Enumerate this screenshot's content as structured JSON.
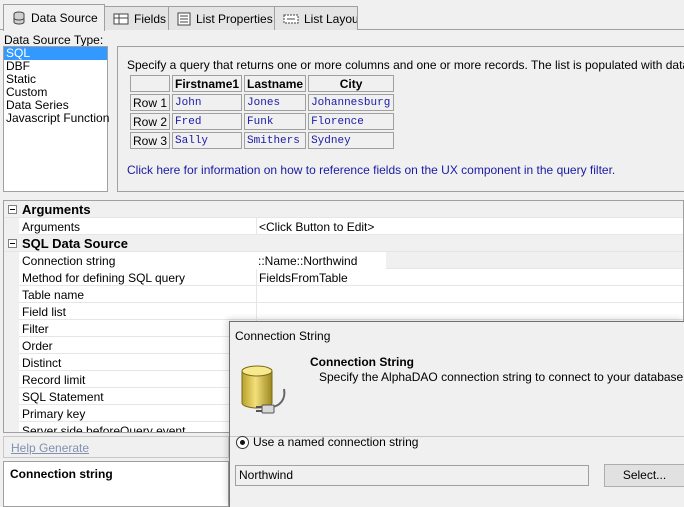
{
  "tabs": [
    {
      "label": "Data Source",
      "icon": "database-icon",
      "active": true
    },
    {
      "label": "Fields",
      "icon": "fields-icon",
      "active": false
    },
    {
      "label": "List Properties",
      "icon": "properties-icon",
      "active": false
    },
    {
      "label": "List Layout",
      "icon": "layout-icon",
      "active": false
    }
  ],
  "data_source": {
    "type_label": "Data Source Type:",
    "types": [
      "SQL",
      "DBF",
      "Static",
      "Custom",
      "Data Series",
      "Javascript Function"
    ],
    "selected": "SQL"
  },
  "info": {
    "text": "Specify a query that returns one or more columns and one or more records. The list is populated with data from the",
    "table": {
      "headers": [
        "",
        "Firstname1",
        "Lastname",
        "City"
      ],
      "rows": [
        [
          "Row 1",
          "John",
          "Jones",
          "Johannesburg"
        ],
        [
          "Row 2",
          "Fred",
          "Funk",
          "Florence"
        ],
        [
          "Row 3",
          "Sally",
          "Smithers",
          "Sydney"
        ]
      ]
    },
    "link": "Click here for information on how to reference fields on the UX component in the query filter."
  },
  "properties": {
    "cat_arguments": "Arguments",
    "arguments_name": "Arguments",
    "arguments_value": "<Click Button to Edit>",
    "cat_sql": "SQL Data Source",
    "rows": [
      {
        "name": "Connection string",
        "value": "::Name::Northwind"
      },
      {
        "name": "Method for defining SQL query",
        "value": "FieldsFromTable"
      },
      {
        "name": "Table name",
        "value": ""
      },
      {
        "name": "Field list",
        "value": ""
      },
      {
        "name": "Filter",
        "value": ""
      },
      {
        "name": "Order",
        "value": ""
      },
      {
        "name": "Distinct",
        "value": ""
      },
      {
        "name": "Record limit",
        "value": ""
      },
      {
        "name": "SQL Statement",
        "value": ""
      },
      {
        "name": "Primary key",
        "value": ""
      },
      {
        "name": "Server side beforeQuery event",
        "value": ""
      }
    ]
  },
  "help_generate": "Help Generate",
  "description_title": "Connection string",
  "dialog": {
    "title": "Connection String",
    "header_title": "Connection String",
    "header_subtitle": "Specify the AlphaDAO connection string to connect to your database.",
    "radio_label": "Use a named connection string",
    "connection_value": "Northwind",
    "select_button": "Select..."
  }
}
